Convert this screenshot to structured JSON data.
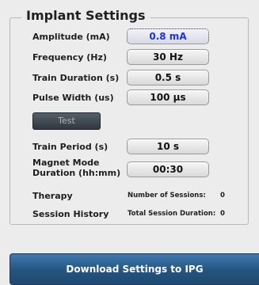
{
  "section": {
    "title": "Implant Settings"
  },
  "settings": [
    {
      "label": "Amplitude (mA)",
      "value": "0.8 mA"
    },
    {
      "label": "Frequency (Hz)",
      "value": "30 Hz"
    },
    {
      "label": "Train Duration (s)",
      "value": "0.5 s"
    },
    {
      "label": "Pulse Width (us)",
      "value": "100 µs"
    },
    {
      "label": "Train Period (s)",
      "value": "10 s"
    },
    {
      "label_line1": "Magnet Mode",
      "label_line2": "Duration (hh:mm)",
      "value": "00:30"
    }
  ],
  "test_button": {
    "label": "Test"
  },
  "therapy": {
    "label": "Therapy",
    "sessions_label": "Number of Sessions:",
    "sessions_value": "0"
  },
  "session_history": {
    "label": "Session History",
    "duration_label": "Total Session Duration:",
    "duration_value": "0"
  },
  "download_button": {
    "label": "Download Settings to IPG"
  },
  "colors": {
    "active_value": "#1c33e8",
    "download_bg": "#2a5f8f"
  }
}
